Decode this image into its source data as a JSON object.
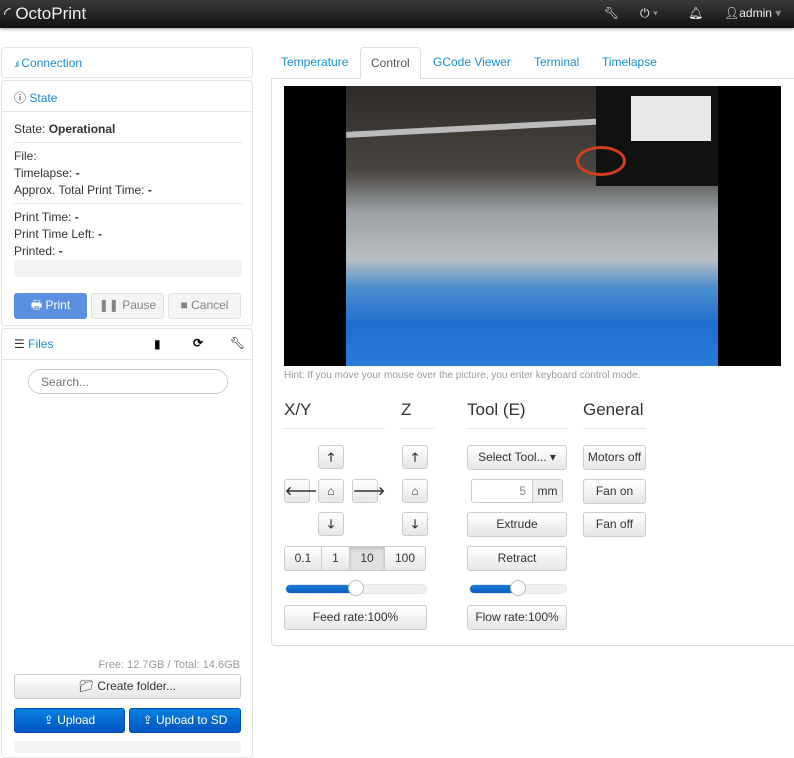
{
  "navbar": {
    "brand": "OctoPrint",
    "user": "admin",
    "icons": [
      "wrench-icon",
      "power-icon",
      "bell-icon",
      "user-icon"
    ]
  },
  "sidebar": {
    "connection": {
      "title": "Connection"
    },
    "state": {
      "title": "State",
      "state_label": "State:",
      "state_value": "Operational",
      "file_label": "File:",
      "timelapse_label": "Timelapse:",
      "timelapse_value": "-",
      "approx_label": "Approx. Total Print Time:",
      "approx_value": "-",
      "print_time_label": "Print Time:",
      "print_time_value": "-",
      "time_left_label": "Print Time Left:",
      "time_left_value": "-",
      "printed_label": "Printed:",
      "printed_value": "-",
      "progress": 0,
      "print": "Print",
      "pause": "Pause",
      "cancel": "Cancel"
    },
    "files": {
      "title": "Files",
      "search_placeholder": "Search...",
      "storage": "Free: 12.7GB / Total: 14.6GB",
      "create_folder": "Create folder...",
      "upload": "Upload",
      "upload_sd": "Upload to SD"
    }
  },
  "tabs": [
    {
      "label": "Temperature"
    },
    {
      "label": "Control",
      "active": true
    },
    {
      "label": "GCode Viewer"
    },
    {
      "label": "Terminal"
    },
    {
      "label": "Timelapse"
    }
  ],
  "control": {
    "hint": "Hint: If you move your mouse over the picture, you enter keyboard control mode.",
    "xy": {
      "title": "X/Y",
      "steps": [
        "0.1",
        "1",
        "10",
        "100"
      ],
      "active_step": "10",
      "feed_rate": "Feed rate:100%",
      "feed_slider": 0.5
    },
    "z": {
      "title": "Z"
    },
    "tool": {
      "title": "Tool (E)",
      "select": "Select Tool...",
      "amount": "5",
      "unit": "mm",
      "extrude": "Extrude",
      "retract": "Retract",
      "flow_rate": "Flow rate:100%",
      "flow_slider": 0.5
    },
    "general": {
      "title": "General",
      "motors_off": "Motors off",
      "fan_on": "Fan on",
      "fan_off": "Fan off"
    }
  }
}
